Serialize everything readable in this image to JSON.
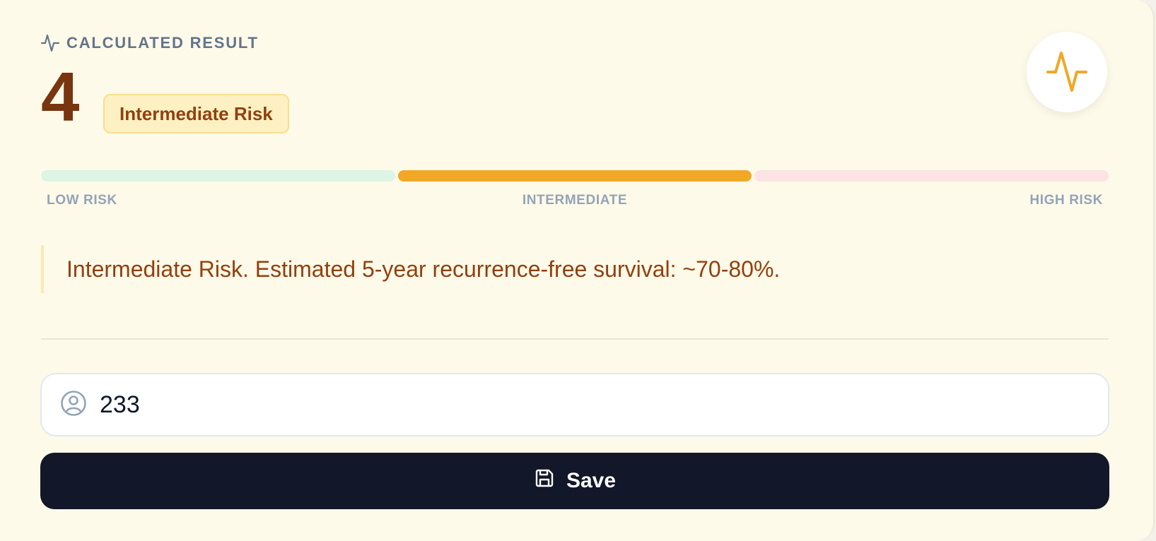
{
  "result": {
    "header_label": "CALCULATED RESULT",
    "score": "4",
    "risk_badge": "Intermediate Risk",
    "header_icon": "activity-icon",
    "accent_color": "#f0a826"
  },
  "risk_scale": {
    "labels": [
      "LOW RISK",
      "INTERMEDIATE",
      "HIGH RISK"
    ],
    "active_segment": "INTERMEDIATE",
    "colors": {
      "low": "#dcf5e4",
      "intermediate": "#f0a826",
      "high": "#fde3e3"
    }
  },
  "interpretation": "Intermediate Risk. Estimated 5-year recurrence-free survival: ~70-80%.",
  "patient_field": {
    "icon": "user-circle-icon",
    "value": "233"
  },
  "save_button": {
    "label": "Save",
    "icon": "save-icon"
  }
}
